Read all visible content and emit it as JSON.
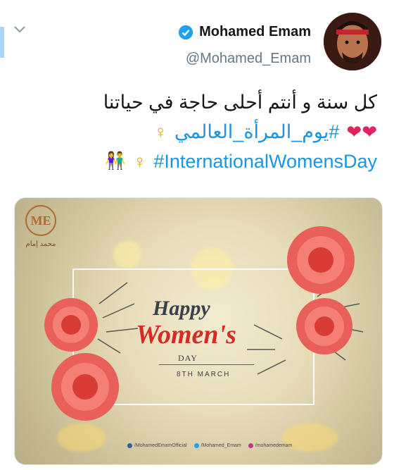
{
  "author": {
    "display_name": "Mohamed Emam",
    "handle": "@Mohamed_Emam",
    "verified_icon": "verified-badge-icon"
  },
  "tweet": {
    "line1": "كل سنة و أنتم أحلى حاجة في حياتنا",
    "hashtag_ar": "#يوم_المرأة_العالمي",
    "hashtag_en": "#InternationalWomensDay",
    "heart_emoji": "❤❤",
    "female_sign": "♀",
    "couple_emoji": "👫"
  },
  "media": {
    "logo_initials": "ME",
    "logo_caption": "محمد إمام",
    "happy": "Happy",
    "womens": "Women's",
    "day": "DAY",
    "date": "8TH MARCH",
    "footer": [
      "/MohamedEmamOfficial",
      "/Mohamed_Emam",
      "/mohamedemam"
    ]
  },
  "colors": {
    "link": "#1b95e0",
    "heart": "#e0245e",
    "verified": "#1da1f2"
  }
}
